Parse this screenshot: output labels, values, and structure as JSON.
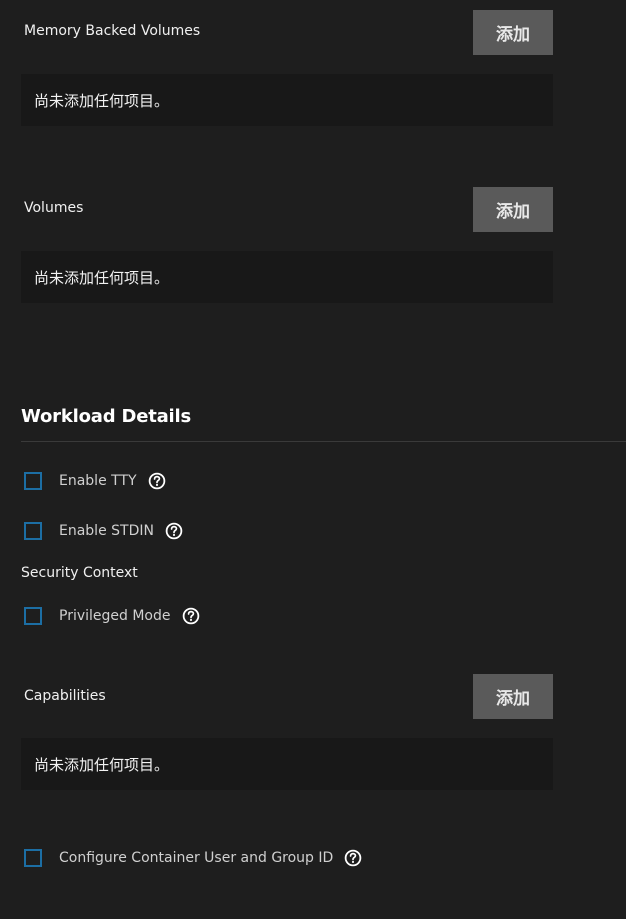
{
  "memory_volumes": {
    "title": "Memory Backed Volumes",
    "add_label": "添加",
    "empty_text": "尚未添加任何项目。"
  },
  "volumes": {
    "title": "Volumes",
    "add_label": "添加",
    "empty_text": "尚未添加任何项目。"
  },
  "workload": {
    "title": "Workload Details",
    "enable_tty": "Enable TTY",
    "enable_stdin": "Enable STDIN",
    "security_context": "Security Context",
    "privileged_mode": "Privileged Mode"
  },
  "capabilities": {
    "title": "Capabilities",
    "add_label": "添加",
    "empty_text": "尚未添加任何项目。"
  },
  "container_user": {
    "label": "Configure Container User and Group ID"
  },
  "colors": {
    "background": "#1e1e1e",
    "button": "#5a5a5a",
    "checkbox_border": "#1c6ea4",
    "empty_box": "#181818"
  }
}
